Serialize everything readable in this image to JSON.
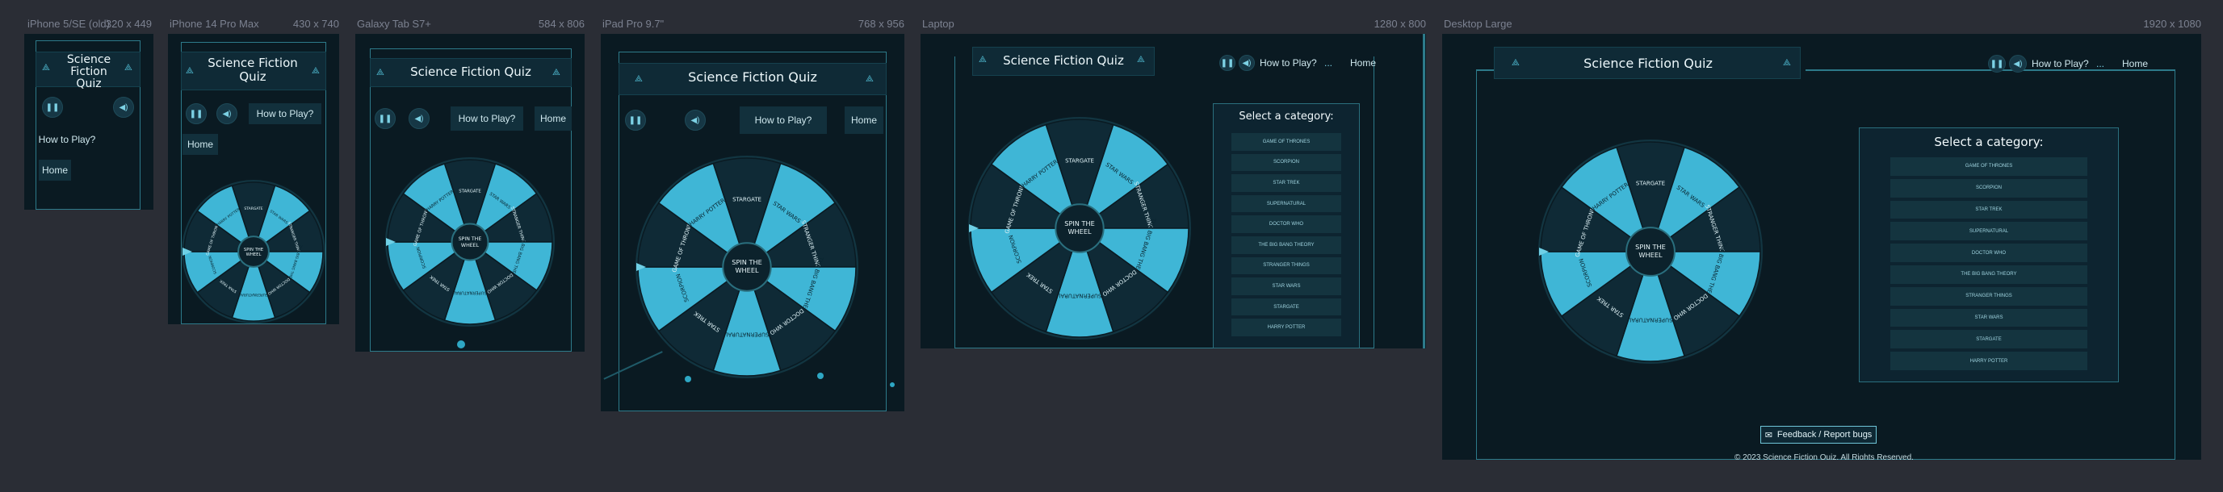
{
  "app": {
    "title": "Science Fiction Quiz",
    "how_to_play": "How to Play?",
    "home": "Home",
    "pause_icon": "pause-icon",
    "sound_icon": "sound-icon",
    "logo_icon": "triangle-logo-icon",
    "select_category": "Select a category:",
    "feedback": "Feedback / Report bugs",
    "copyright": "© 2023 Science Fiction Quiz. All Rights Reserved.",
    "spin": "SPIN THE WHEEL",
    "accent": "#3fb6d6",
    "bg": "#0a1a22"
  },
  "wheel_segments": [
    "STARGATE",
    "STAR WARS",
    "STRANGER THINGS",
    "THE BIG BANG THEORY",
    "DOCTOR WHO",
    "SUPERNATURAL",
    "STAR TREK",
    "SCORPION",
    "GAME OF THRONES",
    "HARRY POTTER"
  ],
  "categories": [
    "GAME OF THRONES",
    "SCORPION",
    "STAR TREK",
    "SUPERNATURAL",
    "DOCTOR WHO",
    "THE BIG BANG THEORY",
    "STRANGER THINGS",
    "STAR WARS",
    "STARGATE",
    "HARRY POTTER"
  ],
  "frames": [
    {
      "name": "iPhone 5/SE (old)",
      "dims": "320 x 449"
    },
    {
      "name": "iPhone 14 Pro Max",
      "dims": "430 x 740"
    },
    {
      "name": "Galaxy Tab S7+",
      "dims": "584 x 806"
    },
    {
      "name": "iPad Pro 9.7\"",
      "dims": "768 x 956"
    },
    {
      "name": "Laptop",
      "dims": "1280 x 800"
    },
    {
      "name": "Desktop Large",
      "dims": "1920 x 1080"
    }
  ]
}
